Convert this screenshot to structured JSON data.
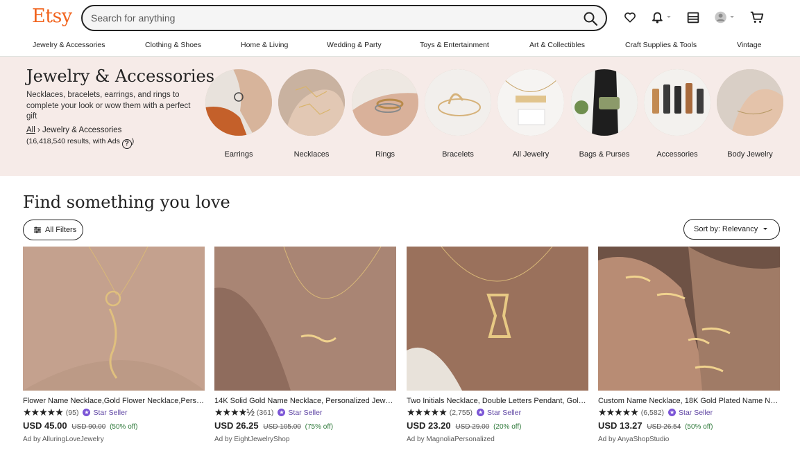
{
  "header": {
    "logo": "Etsy",
    "search_placeholder": "Search for anything"
  },
  "categories": [
    "Jewelry & Accessories",
    "Clothing & Shoes",
    "Home & Living",
    "Wedding & Party",
    "Toys & Entertainment",
    "Art & Collectibles",
    "Craft Supplies & Tools",
    "Vintage"
  ],
  "hero": {
    "title": "Jewelry & Accessories",
    "description": "Necklaces, bracelets, earrings, and rings to complete your look or wow them with a perfect gift",
    "breadcrumb_root": "All",
    "breadcrumb_separator": "›",
    "breadcrumb_current": "Jewelry & Accessories",
    "results": "(16,418,540 results, with Ads",
    "help_symbol": "?",
    "results_close": ")",
    "circles": [
      {
        "label": "Earrings"
      },
      {
        "label": "Necklaces"
      },
      {
        "label": "Rings"
      },
      {
        "label": "Bracelets"
      },
      {
        "label": "All Jewelry"
      },
      {
        "label": "Bags & Purses"
      },
      {
        "label": "Accessories"
      },
      {
        "label": "Body Jewelry"
      }
    ]
  },
  "listing": {
    "title": "Find something you love",
    "filters_label": "All Filters",
    "sort_prefix": "Sort by:",
    "sort_value": "Relevancy"
  },
  "products": [
    {
      "title": "Flower Name Necklace,Gold Flower Necklace,Personalized Name Necklace",
      "stars": "★★★★★",
      "count": "(95)",
      "badge": "Star Seller",
      "price": "USD 45.00",
      "original": "USD 90.00",
      "discount": "(50% off)",
      "ad_prefix": "Ad by",
      "shop": "AlluringLoveJewelry"
    },
    {
      "title": "14K Solid Gold Name Necklace, Personalized Jewelry Gift",
      "stars": "★★★★½",
      "count": "(361)",
      "badge": "Star Seller",
      "price": "USD 26.25",
      "original": "USD 105.00",
      "discount": "(75% off)",
      "ad_prefix": "Ad by",
      "shop": "EightJewelryShop"
    },
    {
      "title": "Two Initials Necklace, Double Letters Pendant, Gold Necklace",
      "stars": "★★★★★",
      "count": "(2,755)",
      "badge": "Star Seller",
      "price": "USD 23.20",
      "original": "USD 29.00",
      "discount": "(20% off)",
      "ad_prefix": "Ad by",
      "shop": "MagnoliaPersonalized"
    },
    {
      "title": "Custom Name Necklace, 18K Gold Plated Name Necklace",
      "stars": "★★★★★",
      "count": "(6,582)",
      "badge": "Star Seller",
      "price": "USD 13.27",
      "original": "USD 26.54",
      "discount": "(50% off)",
      "ad_prefix": "Ad by",
      "shop": "AnyaShopStudio"
    }
  ],
  "colors": {
    "brand": "#f1641e",
    "hero_bg": "#f6ebe8",
    "star_seller": "#5e44a3",
    "discount": "#2f7a3b"
  },
  "icons": [
    "search-icon",
    "heart-icon",
    "bell-icon",
    "gift-icon",
    "avatar-icon",
    "cart-icon",
    "filter-icon",
    "caret-down-icon",
    "star-seller-icon"
  ]
}
